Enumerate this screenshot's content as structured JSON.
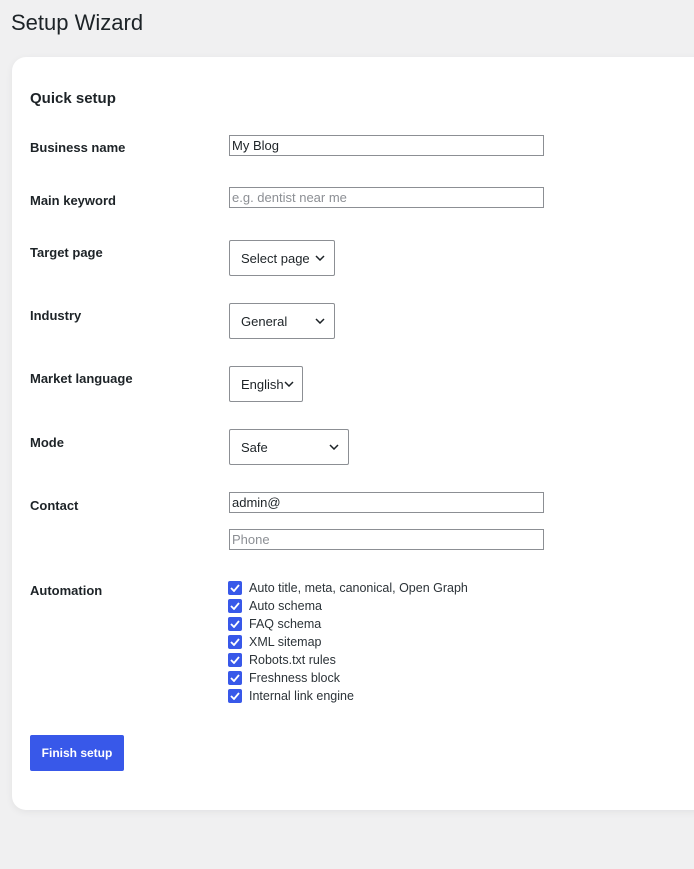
{
  "page": {
    "title": "Setup Wizard"
  },
  "card": {
    "title": "Quick setup",
    "fields": {
      "business_name": {
        "label": "Business name",
        "value": "My Blog"
      },
      "main_keyword": {
        "label": "Main keyword",
        "value": "",
        "placeholder": "e.g. dentist near me"
      },
      "target_page": {
        "label": "Target page",
        "value": "Select page"
      },
      "industry": {
        "label": "Industry",
        "value": "General"
      },
      "market_language": {
        "label": "Market language",
        "value": "English"
      },
      "mode": {
        "label": "Mode",
        "value": "Safe"
      },
      "contact": {
        "label": "Contact",
        "email_value": "admin@",
        "phone_value": "",
        "phone_placeholder": "Phone"
      }
    },
    "automation": {
      "label": "Automation",
      "options": [
        {
          "label": "Auto title, meta, canonical, Open Graph",
          "checked": true
        },
        {
          "label": "Auto schema",
          "checked": true
        },
        {
          "label": "FAQ schema",
          "checked": true
        },
        {
          "label": "XML sitemap",
          "checked": true
        },
        {
          "label": "Robots.txt rules",
          "checked": true
        },
        {
          "label": "Freshness block",
          "checked": true
        },
        {
          "label": "Internal link engine",
          "checked": true
        }
      ]
    },
    "finish_label": "Finish setup"
  },
  "colors": {
    "accent": "#3858e9",
    "background": "#f0f0f1",
    "input_border": "#8c8f94"
  }
}
